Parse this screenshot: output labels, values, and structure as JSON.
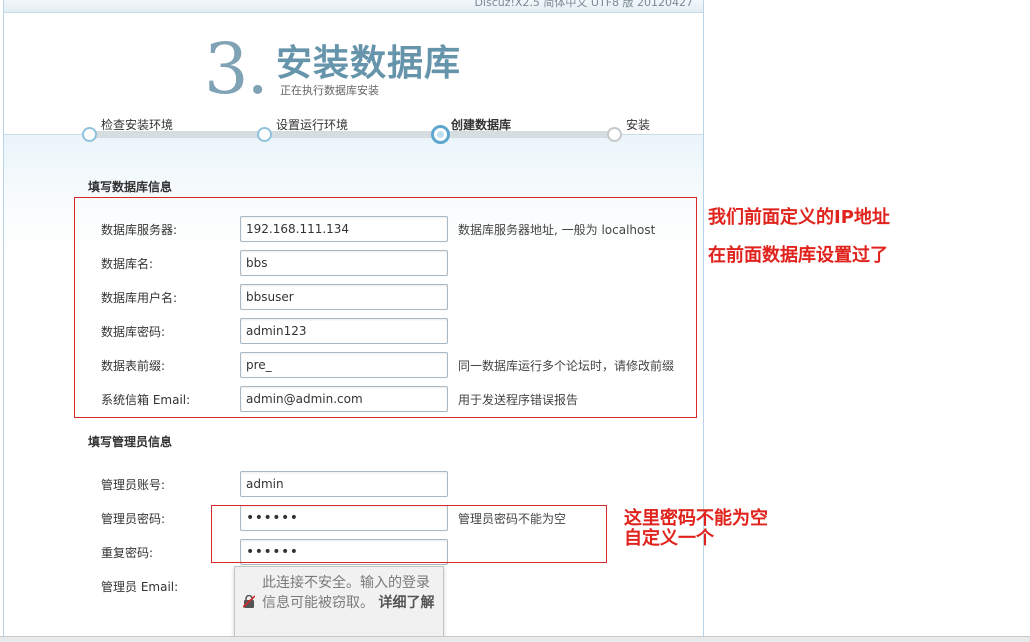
{
  "header": {
    "version": "Discuz!X2.5 简体中文 UTF8 版 20120427",
    "step_number": "3.",
    "title": "安装数据库",
    "subtitle": "正在执行数据库安装"
  },
  "steps": [
    {
      "label": "检查安装环境",
      "state": "done"
    },
    {
      "label": "设置运行环境",
      "state": "done"
    },
    {
      "label": "创建数据库",
      "state": "current"
    },
    {
      "label": "安装",
      "state": "future"
    }
  ],
  "db_section": {
    "title": "填写数据库信息",
    "rows": [
      {
        "label": "数据库服务器:",
        "value": "192.168.111.134",
        "hint": "数据库服务器地址, 一般为 localhost"
      },
      {
        "label": "数据库名:",
        "value": "bbs",
        "hint": ""
      },
      {
        "label": "数据库用户名:",
        "value": "bbsuser",
        "hint": ""
      },
      {
        "label": "数据库密码:",
        "value": "admin123",
        "hint": ""
      },
      {
        "label": "数据表前缀:",
        "value": "pre_",
        "hint": "同一数据库运行多个论坛时，请修改前缀"
      },
      {
        "label": "系统信箱 Email:",
        "value": "admin@admin.com",
        "hint": "用于发送程序错误报告"
      }
    ]
  },
  "admin_section": {
    "title": "填写管理员信息",
    "rows": [
      {
        "label": "管理员账号:",
        "value": "admin",
        "hint": ""
      },
      {
        "label": "管理员密码:",
        "value": "••••••",
        "hint": "管理员密码不能为空"
      },
      {
        "label": "重复密码:",
        "value": "••••••",
        "hint": ""
      },
      {
        "label": "管理员 Email:",
        "value": "",
        "hint": ""
      }
    ]
  },
  "annotations": {
    "db_line1": "我们前面定义的IP地址",
    "db_line2": "在前面数据库设置过了",
    "pwd_line1": "这里密码不能为空",
    "pwd_line2": "自定义一个"
  },
  "tooltip": {
    "text": "此连接不安全。输入的登录信息可能被窃取。",
    "link": "详细了解"
  },
  "colors": {
    "accent": "#6695ab",
    "annotation": "#e0231d"
  }
}
